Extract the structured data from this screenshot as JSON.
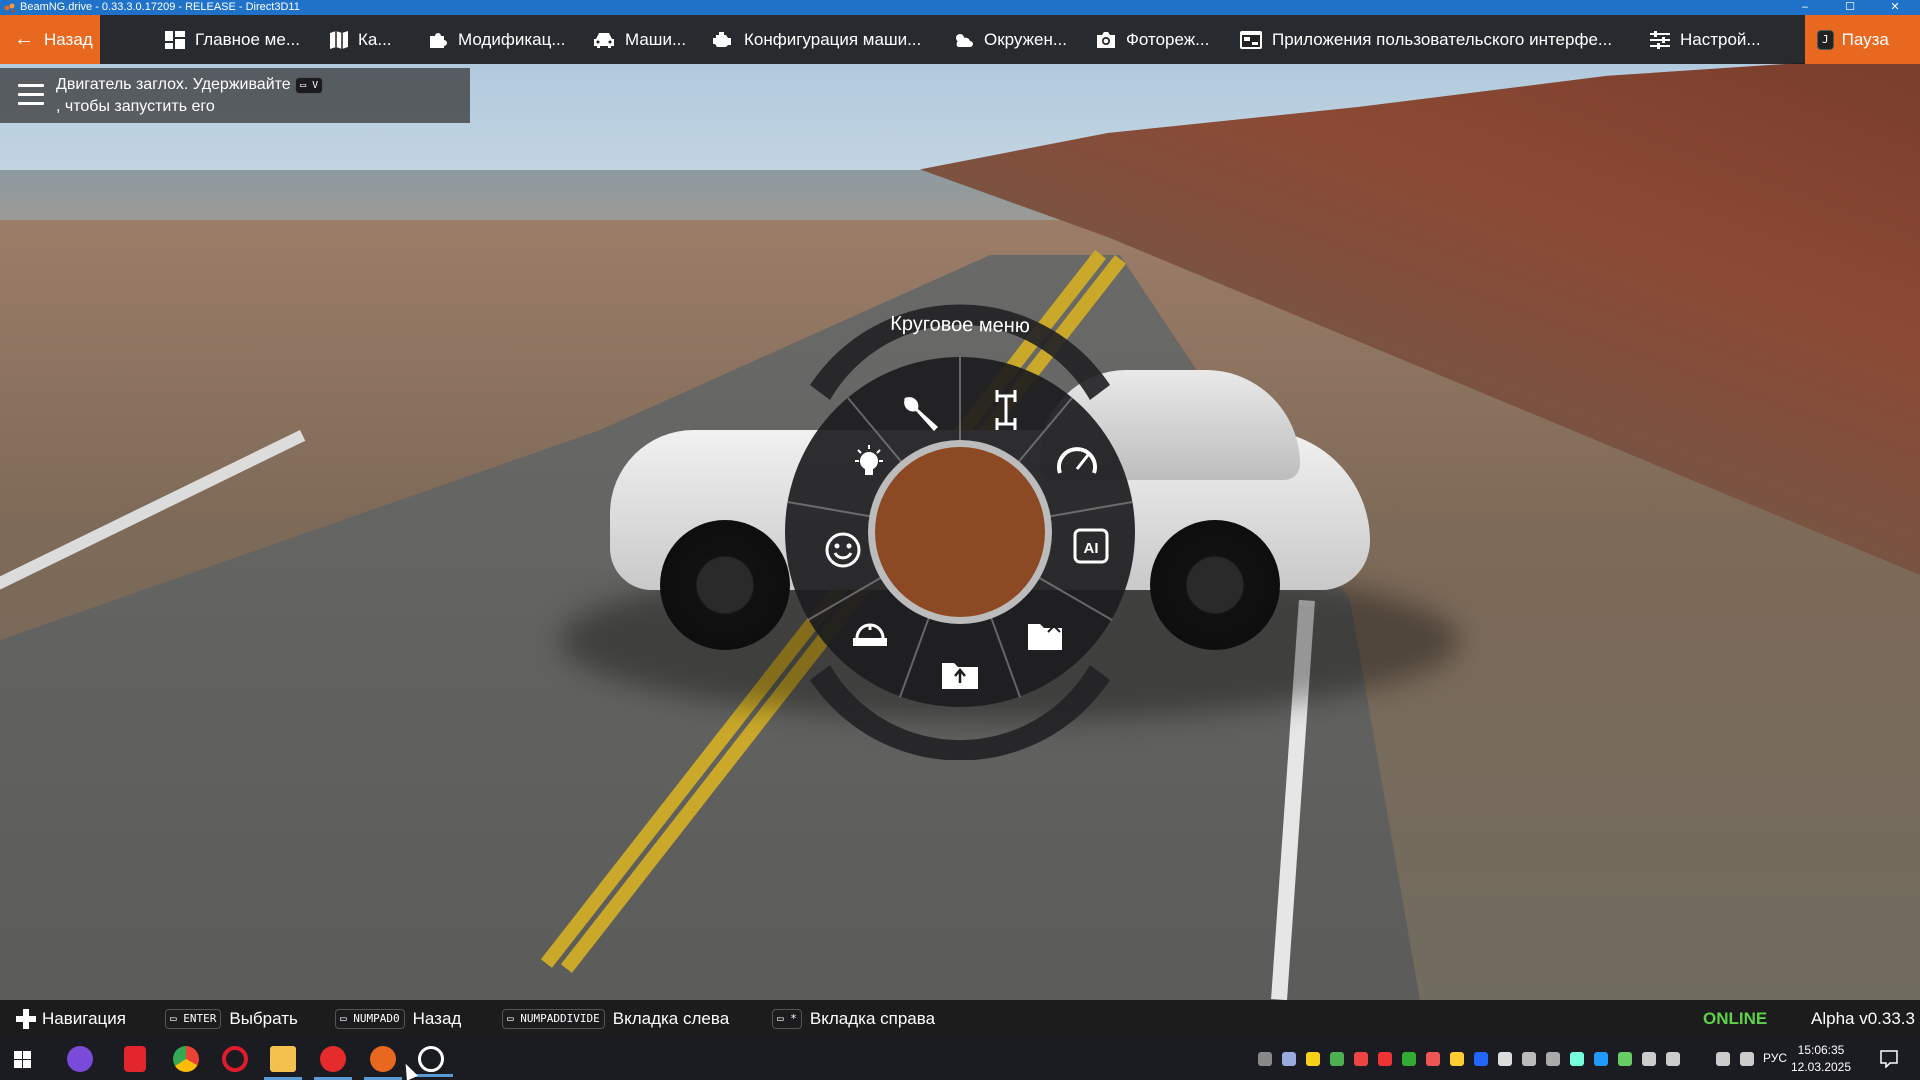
{
  "window": {
    "title": "BeamNG.drive - 0.33.3.0.17209 - RELEASE - Direct3D11",
    "controls": {
      "minimize": "–",
      "maximize": "☐",
      "close": "✕"
    }
  },
  "topbar": {
    "back_label": "Назад",
    "items": [
      {
        "label": "Главное ме...",
        "icon": "dashboard-icon"
      },
      {
        "label": "Ка...",
        "icon": "map-icon"
      },
      {
        "label": "Модификац...",
        "icon": "puzzle-icon"
      },
      {
        "label": "Маши...",
        "icon": "car-icon"
      },
      {
        "label": "Конфигурация маши...",
        "icon": "engine-icon"
      },
      {
        "label": "Окружен...",
        "icon": "weather-icon"
      },
      {
        "label": "Фотореж...",
        "icon": "camera-icon"
      },
      {
        "label": "Приложения пользовательского интерфе...",
        "icon": "ui-apps-icon"
      },
      {
        "label": "Настрой...",
        "icon": "settings-sliders-icon"
      }
    ],
    "pause_key": "J",
    "pause_label": "Пауза"
  },
  "notification": {
    "line1": "Двигатель заглох. Удерживайте",
    "key": "V",
    "line2": ", чтобы запустить его"
  },
  "radial_menu": {
    "title": "Круговое меню",
    "center_color": "#8b4a24",
    "segments": [
      "wrench-icon",
      "drivetrain-icon",
      "gauge-icon",
      "ai-icon",
      "folder-open-icon",
      "folder-save-icon",
      "dashboard-lights-icon",
      "smiley-icon",
      "lightbulb-icon"
    ]
  },
  "hints": {
    "navigation": "Навигация",
    "select_key": "ENTER",
    "select_label": "Выбрать",
    "back_key": "NUMPAD0",
    "back_label": "Назад",
    "tab_left_key": "NUMPADDIVIDE",
    "tab_left_label": "Вкладка слева",
    "tab_right_key": "*",
    "tab_right_label": "Вкладка справа",
    "status": "ONLINE",
    "version": "Alpha v0.33.3"
  },
  "taskbar": {
    "language": "РУС",
    "time": "15:06:35",
    "date": "12.03.2025"
  },
  "colors": {
    "accent": "#e8681f",
    "online": "#5fd14a",
    "titlebar": "#1f72c8"
  }
}
